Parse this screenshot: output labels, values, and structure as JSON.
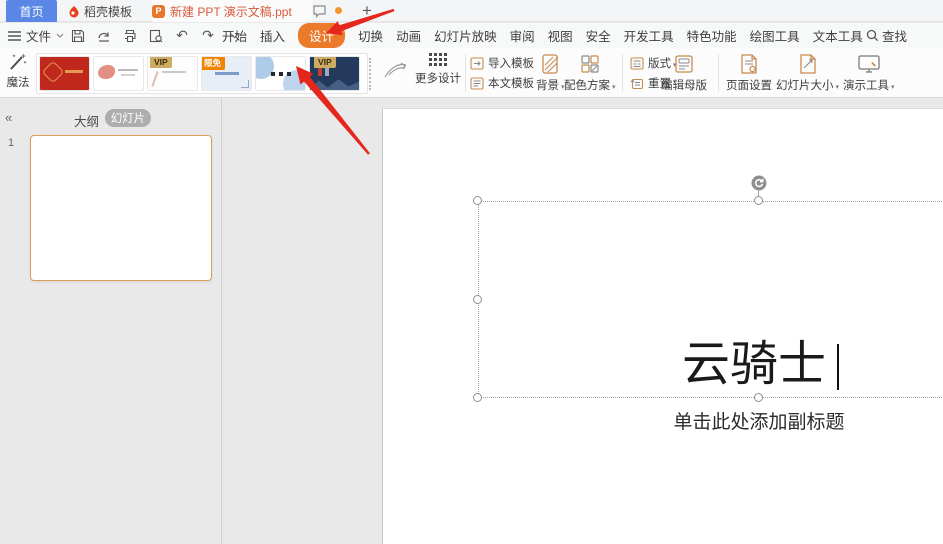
{
  "tabbar": {
    "home": "首页",
    "docer": "稻壳模板",
    "document": "新建 PPT 演示文稿.ppt",
    "doc_icon_letter": "P",
    "new_tab": "+"
  },
  "menubar": {
    "file": "文件",
    "items": [
      "开始",
      "插入",
      "设计",
      "切换",
      "动画",
      "幻灯片放映",
      "审阅",
      "视图",
      "安全",
      "开发工具",
      "特色功能",
      "绘图工具",
      "文本工具"
    ],
    "active_item": "设计",
    "search": "查找"
  },
  "ribbon": {
    "magic": "魔法",
    "more_designs": "更多设计",
    "vip_badge": "VIP",
    "free_badge": "限免",
    "import_template": "导入模板",
    "doc_template": "本文模板",
    "background": "背景",
    "color_scheme": "配色方案",
    "layout": "版式",
    "reset": "重置",
    "edit_master": "编辑母版",
    "page_setup": "页面设置",
    "slide_size": "幻灯片大小",
    "present_tools": "演示工具"
  },
  "sidebar": {
    "collapse": "«",
    "outline_tab": "大纲",
    "slides_tab": "幻灯片",
    "slide_number": "1"
  },
  "slide": {
    "title": "云骑士",
    "subtitle_placeholder": "单击此处添加副标题"
  },
  "colors": {
    "accent_orange": "#ec7a2b",
    "tab_blue": "#5a87e6",
    "arrow_red": "#e5261d",
    "doc_tab_text": "#d85a3c",
    "thumb_selected_border": "#e09a5a"
  }
}
